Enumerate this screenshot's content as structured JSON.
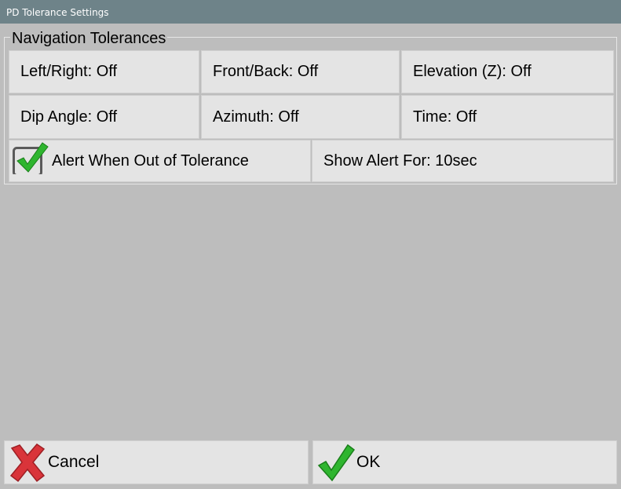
{
  "window": {
    "title": "PD Tolerance Settings"
  },
  "group": {
    "title": "Navigation Tolerances",
    "settings": [
      {
        "label": "Left/Right: Off"
      },
      {
        "label": "Front/Back: Off"
      },
      {
        "label": "Elevation (Z): Off"
      },
      {
        "label": "Dip Angle: Off"
      },
      {
        "label": "Azimuth: Off"
      },
      {
        "label": "Time: Off"
      }
    ],
    "alert_checkbox": {
      "label": "Alert When Out of Tolerance",
      "checked": true
    },
    "show_alert": {
      "label": "Show Alert For: 10sec"
    }
  },
  "buttons": {
    "cancel": {
      "label": "Cancel",
      "icon": "red-x-icon"
    },
    "ok": {
      "label": "OK",
      "icon": "green-check-icon"
    }
  },
  "colors": {
    "titlebar": "#6e8389",
    "background": "#bdbdbd",
    "cell": "#e4e4e4",
    "check_green": "#2fb52f",
    "cancel_red": "#d9343a"
  }
}
